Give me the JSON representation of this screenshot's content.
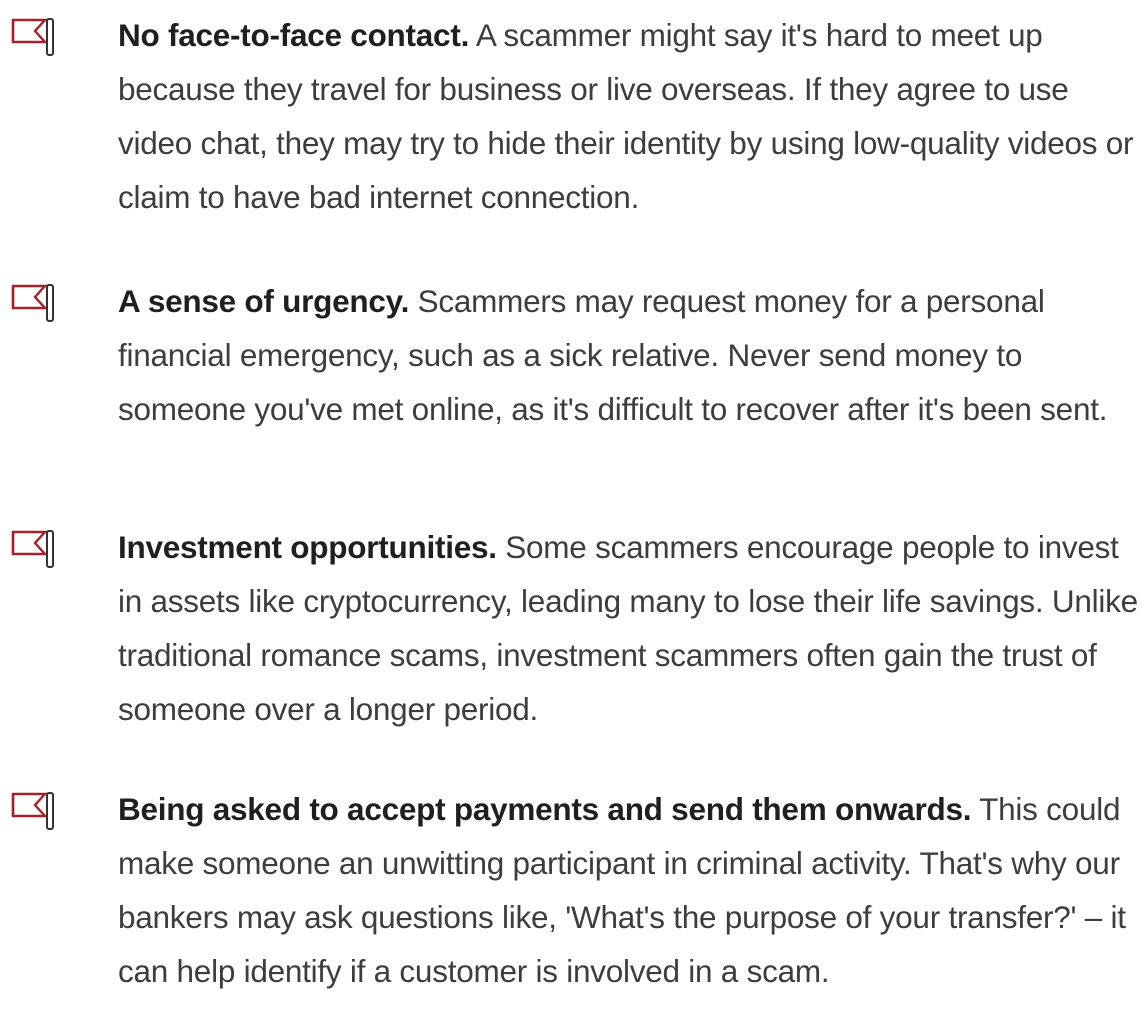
{
  "items": [
    {
      "icon": "red-flag-icon",
      "heading": "No face-to-face contact.",
      "body": " A scammer might say it's hard to meet up because they travel for business or live overseas. If they agree to use video chat, they may try to hide their identity by using low-quality videos or claim to have bad internet connection."
    },
    {
      "icon": "red-flag-icon",
      "heading": "A sense of urgency.",
      "body": " Scammers may request money for a personal financial emergency, such as a sick relative. Never send money to someone you've met online, as it's difficult to recover after it's been sent."
    },
    {
      "icon": "red-flag-icon",
      "heading": "Investment opportunities.",
      "body": " Some scammers encourage people to invest in assets like cryptocurrency, leading many to lose their life savings. Unlike traditional romance scams, investment scammers often gain the trust of someone over a longer period."
    },
    {
      "icon": "red-flag-icon",
      "heading": "Being asked to accept payments and send them onwards.",
      "body": " This could make someone an unwitting participant in criminal activity. That's why our bankers may ask questions like, 'What's the purpose of your transfer?' – it can help identify if a customer is involved in a scam."
    }
  ],
  "colors": {
    "flag": "#a8202a",
    "pole": "#333333",
    "heading": "#1f1f1f",
    "text": "#3d3d3d"
  }
}
